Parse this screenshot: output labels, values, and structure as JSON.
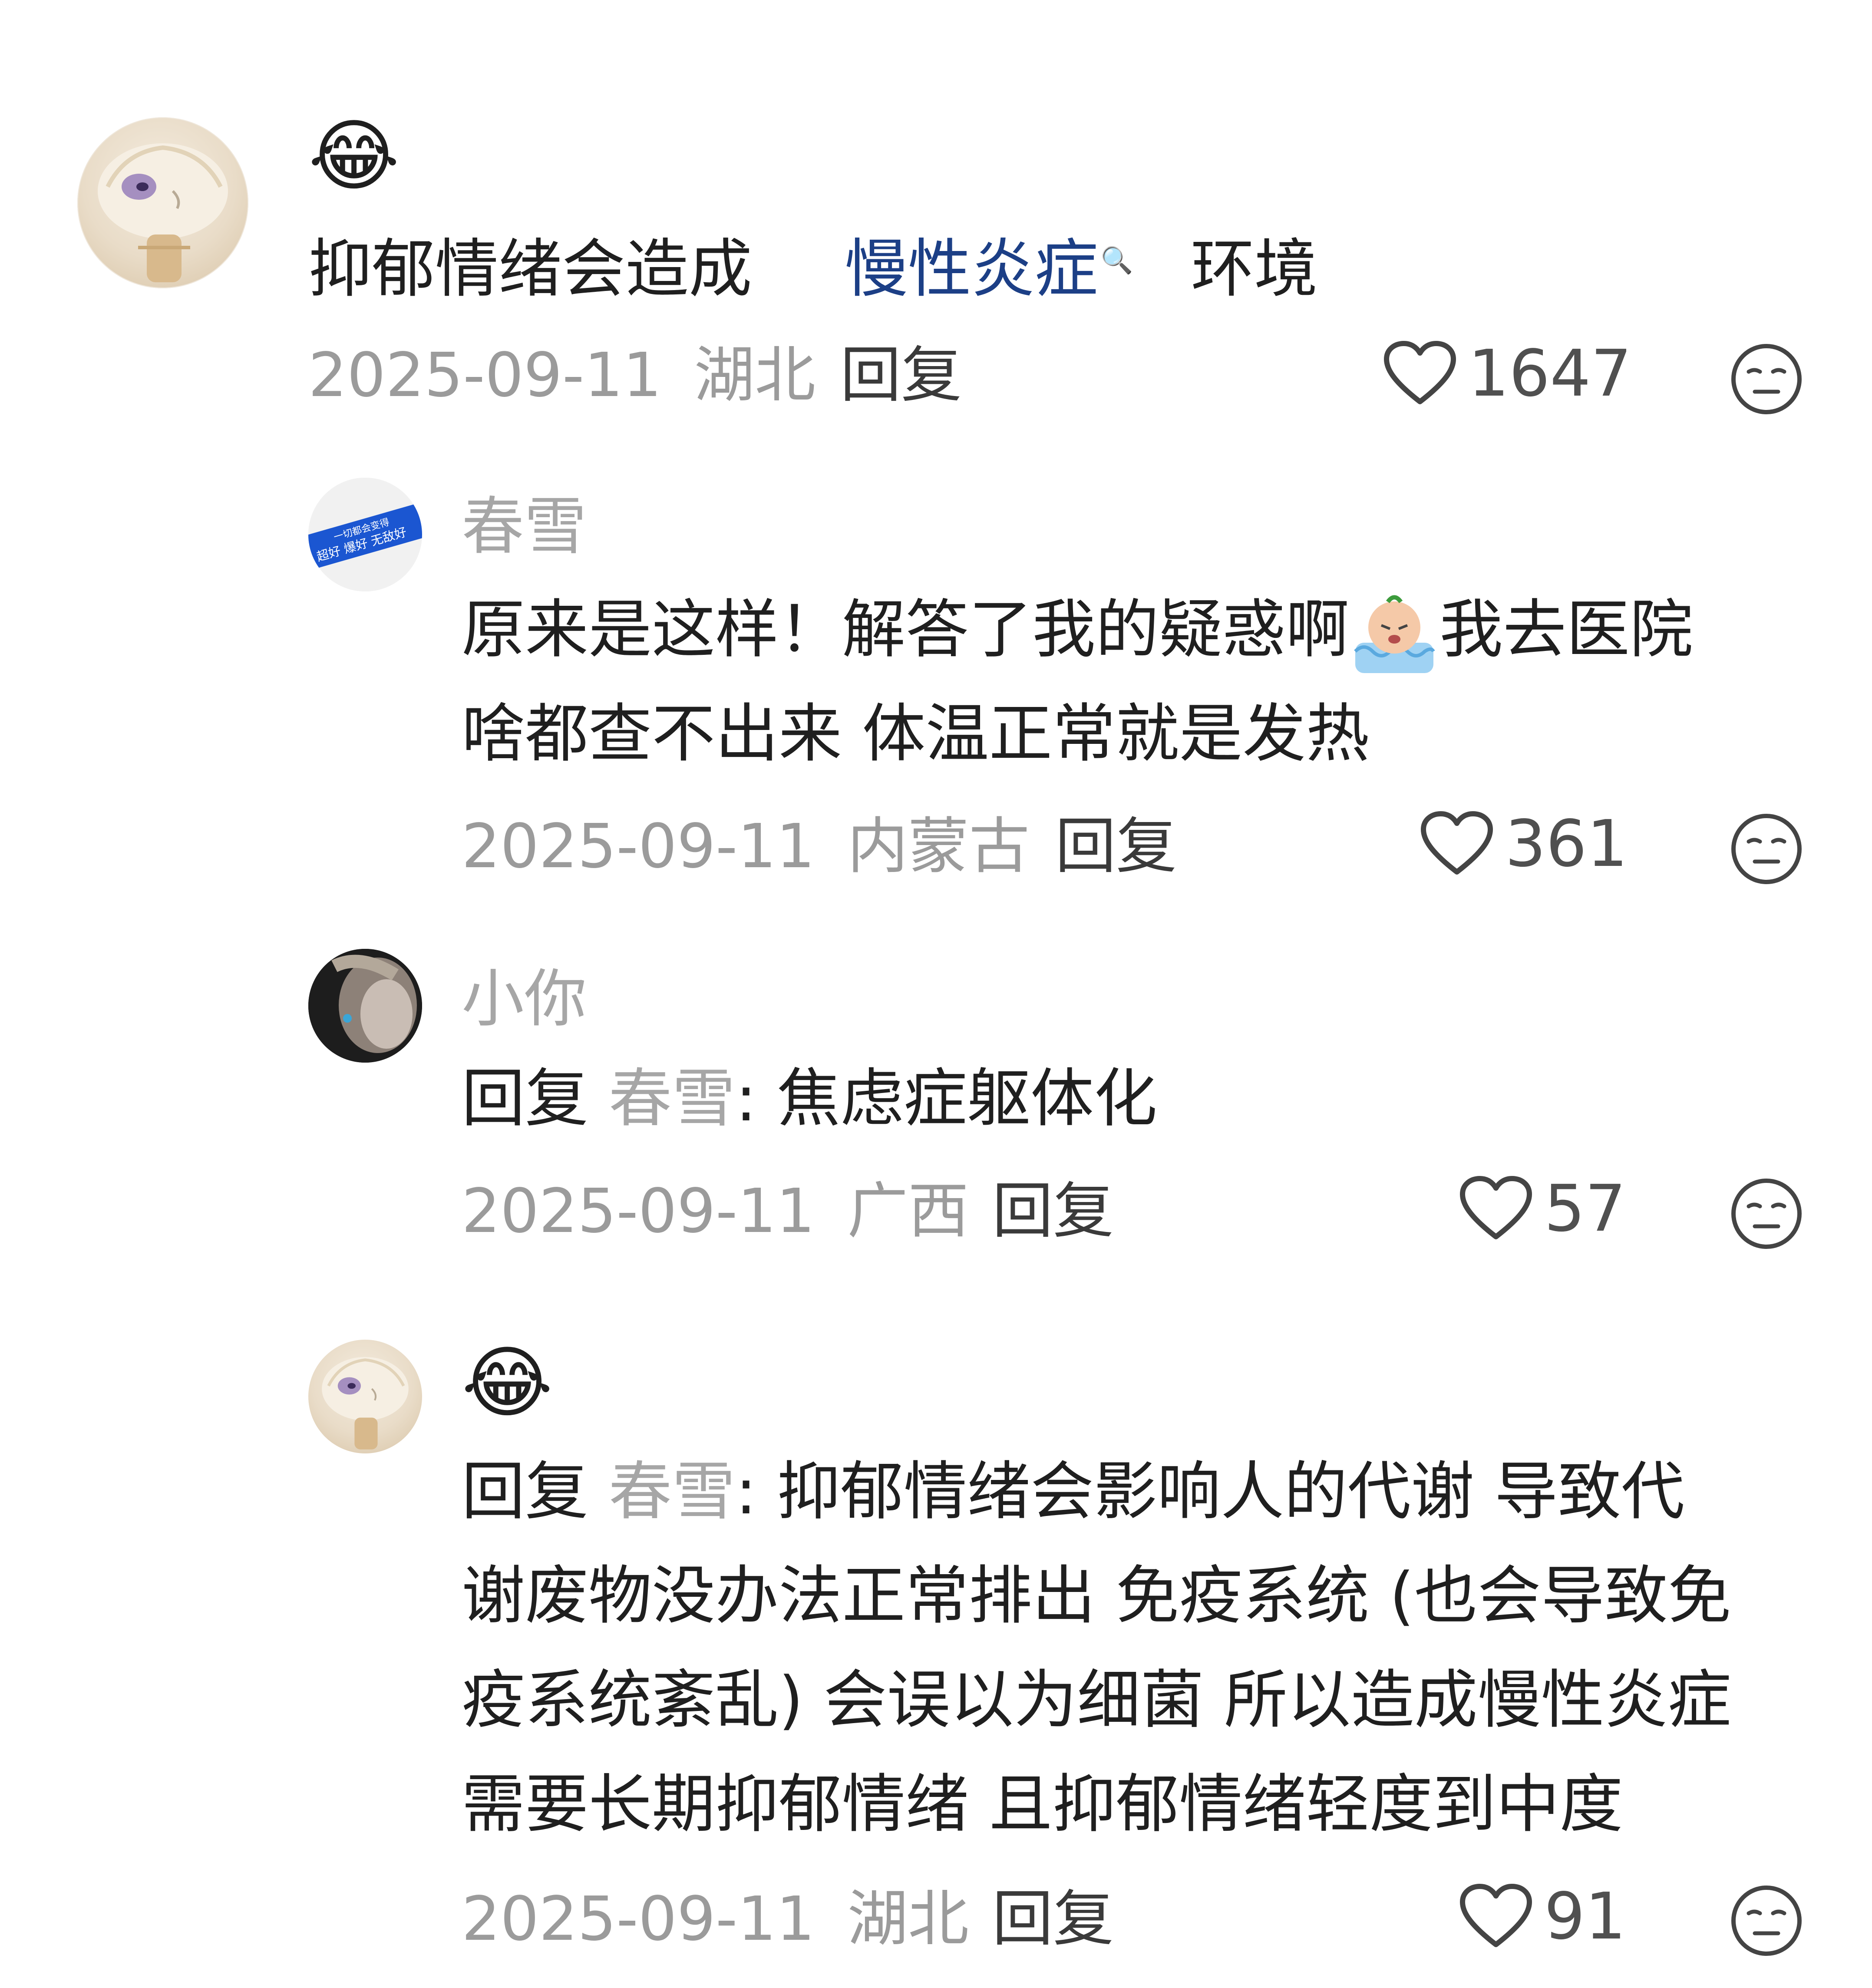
{
  "comments": [
    {
      "emoji": "😂",
      "text_segments": [
        {
          "text": "抑郁情绪会造成"
        },
        {
          "text": "慢性炎症"
        },
        {
          "text": "环境"
        }
      ],
      "date": "2025-09-11",
      "location": "湖北",
      "reply_label": "回复",
      "likes": "1647"
    }
  ],
  "replies": [
    {
      "username": "春雪",
      "avatar_text": [
        "一切都会变得",
        "超好 爆好 无敌好"
      ],
      "text_lines": [
        "原来是这样！解答了我的疑惑啊",
        "我去医院",
        "啥都查不出来 体温正常就是发热"
      ],
      "date": "2025-09-11",
      "location": "内蒙古",
      "reply_label": "回复",
      "likes": "361"
    },
    {
      "username": "小你",
      "reply_prefix": "回复",
      "reply_to": "春雪",
      "text": ": 焦虑症躯体化",
      "date": "2025-09-11",
      "location": "广西",
      "reply_label": "回复",
      "likes": "57"
    },
    {
      "emoji": "😂",
      "reply_prefix": "回复",
      "reply_to": "春雪",
      "text_lines": [
        ": 抑郁情绪会影响人的代谢  导致代",
        "谢废物没办法正常排出  免疫系统 (也会导致免",
        "疫系统紊乱) 会误以为细菌  所以造成慢性炎症",
        "需要长期抑郁情绪  且抑郁情绪轻度到中度"
      ],
      "date": "2025-09-11",
      "location": "湖北",
      "reply_label": "回复",
      "likes": "91"
    }
  ],
  "icons": {
    "like": "heart-outline-icon",
    "reaction": "unamused-face-icon",
    "search": "search-icon"
  },
  "colors": {
    "link": "#1c3f86",
    "meta": "#9b9b9b",
    "username": "#a6a6a6",
    "text": "#1f1f1f"
  }
}
